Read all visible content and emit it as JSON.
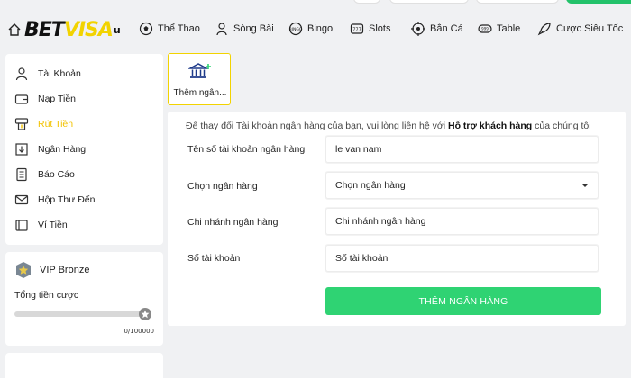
{
  "brand": {
    "name_a": "BET",
    "name_b": "VISA",
    "tail": "u"
  },
  "nav": {
    "items": [
      {
        "label": "Thể Thao",
        "icon": "soccer-ball-icon"
      },
      {
        "label": "Sòng Bài",
        "icon": "dealer-icon"
      },
      {
        "label": "Bingo",
        "icon": "bingo-icon"
      },
      {
        "label": "Slots",
        "icon": "slot-machine-icon"
      },
      {
        "label": "Bắn Cá",
        "icon": "target-icon"
      },
      {
        "label": "Table",
        "icon": "table-game-icon"
      },
      {
        "label": "Cược Siêu Tốc",
        "icon": "rocket-icon"
      }
    ]
  },
  "sidebar": {
    "items": [
      {
        "label": "Tài Khoản",
        "icon": "user-icon",
        "active": false
      },
      {
        "label": "Nạp Tiền",
        "icon": "wallet-icon",
        "active": false
      },
      {
        "label": "Rút Tiền",
        "icon": "withdraw-icon",
        "active": true
      },
      {
        "label": "Ngân Hàng",
        "icon": "bank-icon",
        "active": false
      },
      {
        "label": "Báo Cáo",
        "icon": "report-icon",
        "active": false
      },
      {
        "label": "Hộp Thư Đến",
        "icon": "mail-icon",
        "active": false
      },
      {
        "label": "Ví Tiền",
        "icon": "purse-icon",
        "active": false
      }
    ],
    "active_color": "#f2c200"
  },
  "vip": {
    "level": "VIP Bronze",
    "bet_label": "Tổng tiền cược",
    "progress_text": "0/100000",
    "progress_fraction": 0
  },
  "main": {
    "add_bank_tile": "Thêm ngân...",
    "notice_prefix": "Để thay đổi Tài khoản ngân hàng của bạn, vui lòng liên hệ với ",
    "notice_link": "Hỗ trợ khách hàng",
    "notice_suffix": " của chúng tôi",
    "form": {
      "account_name_label": "Tên số tài khoản ngân hàng",
      "account_name_value": "le van nam",
      "bank_label": "Chọn ngân hàng",
      "bank_value": "Chọn ngân hàng",
      "branch_label": "Chi nhánh ngân hàng",
      "branch_placeholder": "Chi nhánh ngân hàng",
      "account_number_label": "Số tài khoản",
      "account_number_placeholder": "Số tài khoản",
      "submit_label": "THÊM NGÂN HÀNG"
    }
  },
  "colors": {
    "accent_yellow": "#f2d300",
    "submit_green": "#2fd373"
  }
}
